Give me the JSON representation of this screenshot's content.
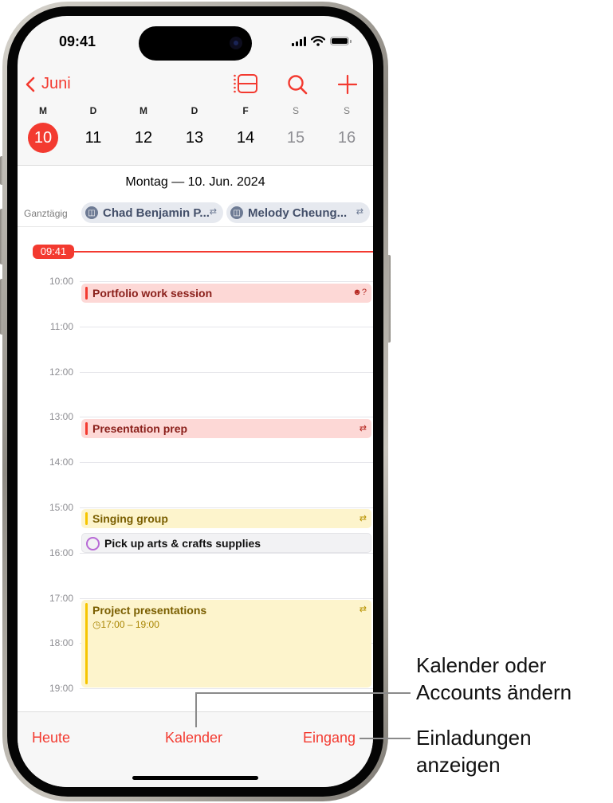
{
  "status_bar": {
    "time": "09:41"
  },
  "nav": {
    "back_label": "Juni",
    "icons": [
      "list-view-icon",
      "search-icon",
      "add-icon"
    ]
  },
  "week": {
    "days": [
      {
        "letter": "M",
        "num": "10",
        "selected": true,
        "weekend": false
      },
      {
        "letter": "D",
        "num": "11",
        "selected": false,
        "weekend": false
      },
      {
        "letter": "M",
        "num": "12",
        "selected": false,
        "weekend": false
      },
      {
        "letter": "D",
        "num": "13",
        "selected": false,
        "weekend": false
      },
      {
        "letter": "F",
        "num": "14",
        "selected": false,
        "weekend": false
      },
      {
        "letter": "S",
        "num": "15",
        "selected": false,
        "weekend": true
      },
      {
        "letter": "S",
        "num": "16",
        "selected": false,
        "weekend": true
      }
    ]
  },
  "day": {
    "title": "Montag — 10. Jun. 2024",
    "all_day_label": "Ganztägig",
    "all_day_events": [
      {
        "title": "Chad Benjamin P...",
        "icon": "gift-icon",
        "repeat": true
      },
      {
        "title": "Melody Cheung...",
        "icon": "gift-icon",
        "repeat": true
      }
    ],
    "now": "09:41",
    "hours": [
      "10:00",
      "11:00",
      "12:00",
      "13:00",
      "14:00",
      "15:00",
      "16:00",
      "17:00",
      "18:00",
      "19:00"
    ],
    "events": [
      {
        "title": "Portfolio work session",
        "calendar": "red",
        "icon": "invitee-pending-icon"
      },
      {
        "title": "Presentation prep",
        "calendar": "red",
        "icon": "repeat-icon"
      },
      {
        "title": "Singing group",
        "calendar": "yellow",
        "icon": "repeat-icon"
      },
      {
        "title": "Project presentations",
        "calendar": "yellow",
        "icon": "repeat-icon",
        "time": "17:00 – 19:00"
      }
    ],
    "reminder": {
      "title": "Pick up arts & crafts supplies",
      "completed": false
    }
  },
  "tabbar": {
    "today": "Heute",
    "calendars": "Kalender",
    "inbox": "Eingang"
  },
  "callouts": {
    "calendars": [
      "Kalender oder",
      "Accounts ändern"
    ],
    "inbox": [
      "Einladungen",
      "anzeigen"
    ]
  },
  "colors": {
    "accent": "#f33a30",
    "event_red_bg": "#fdd8d6",
    "event_yellow_bg": "#fdf4cc",
    "reminder_ring": "#b86ad6"
  }
}
